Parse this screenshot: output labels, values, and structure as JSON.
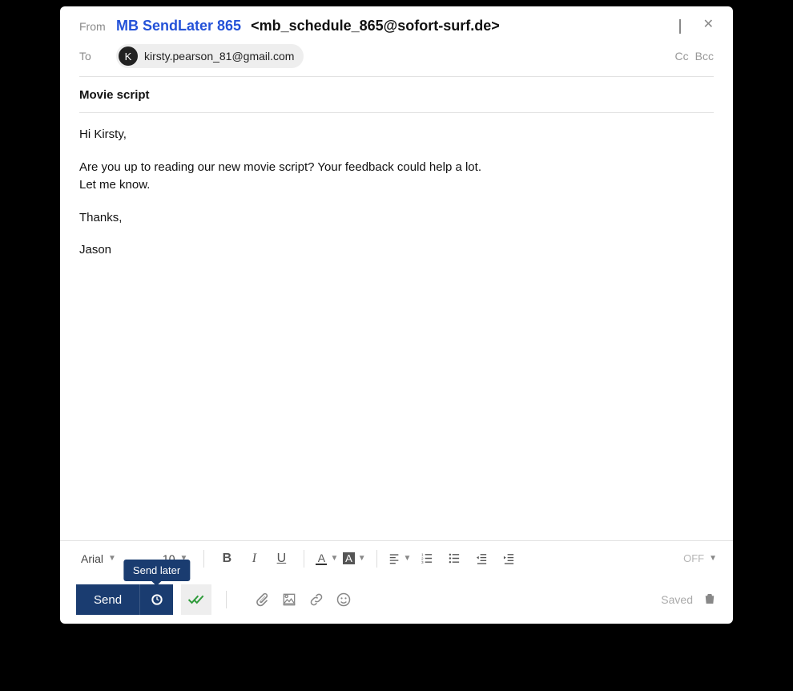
{
  "from": {
    "label": "From",
    "sender_name": "MB SendLater 865",
    "sender_email": "<mb_schedule_865@sofort-surf.de>"
  },
  "to": {
    "label": "To",
    "recipient_initial": "K",
    "recipient_email": "kirsty.pearson_81@gmail.com",
    "cc_label": "Cc",
    "bcc_label": "Bcc"
  },
  "subject": "Movie script",
  "body": {
    "greeting": "Hi Kirsty,",
    "line1": "Are you up to reading our new movie script? Your feedback could help a lot.",
    "line2": "Let me know.",
    "signoff": "Thanks,",
    "name": "Jason"
  },
  "format_toolbar": {
    "font_name": "Arial",
    "font_size": "10",
    "off_label": "OFF"
  },
  "send": {
    "button_label": "Send",
    "tooltip": "Send later",
    "saved_label": "Saved"
  }
}
